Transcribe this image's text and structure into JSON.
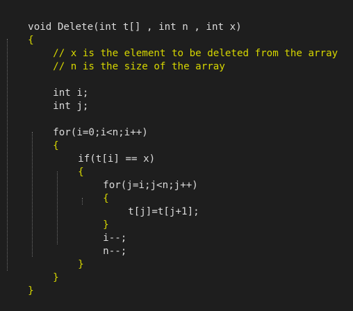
{
  "editor": {
    "lines": [
      {
        "id": "l1",
        "indent": 0,
        "text": "void Delete(int t[] , int n , int x)",
        "kind": "code"
      },
      {
        "id": "l2",
        "indent": 0,
        "text": "{",
        "kind": "brace"
      },
      {
        "id": "l3",
        "indent": 4,
        "text": "// x is the element to be deleted from the array",
        "kind": "comment"
      },
      {
        "id": "l4",
        "indent": 4,
        "text": "// n is the size of the array",
        "kind": "comment"
      },
      {
        "id": "l5",
        "indent": 4,
        "text": "",
        "kind": "code"
      },
      {
        "id": "l6",
        "indent": 4,
        "text": "int i;",
        "kind": "code"
      },
      {
        "id": "l7",
        "indent": 4,
        "text": "int j;",
        "kind": "code"
      },
      {
        "id": "l8",
        "indent": 4,
        "text": "",
        "kind": "code"
      },
      {
        "id": "l9",
        "indent": 4,
        "text": "for(i=0;i<n;i++)",
        "kind": "code"
      },
      {
        "id": "l10",
        "indent": 4,
        "text": "{",
        "kind": "brace"
      },
      {
        "id": "l11",
        "indent": 8,
        "text": "if(t[i] == x)",
        "kind": "code"
      },
      {
        "id": "l12",
        "indent": 8,
        "text": "{",
        "kind": "brace"
      },
      {
        "id": "l13",
        "indent": 12,
        "text": "for(j=i;j<n;j++)",
        "kind": "code"
      },
      {
        "id": "l14",
        "indent": 12,
        "text": "{",
        "kind": "brace"
      },
      {
        "id": "l15",
        "indent": 16,
        "text": "t[j]=t[j+1];",
        "kind": "code"
      },
      {
        "id": "l16",
        "indent": 12,
        "text": "}",
        "kind": "brace"
      },
      {
        "id": "l17",
        "indent": 12,
        "text": "i--;",
        "kind": "code"
      },
      {
        "id": "l18",
        "indent": 12,
        "text": "n--;",
        "kind": "code"
      },
      {
        "id": "l19",
        "indent": 8,
        "text": "}",
        "kind": "brace"
      },
      {
        "id": "l20",
        "indent": 4,
        "text": "}",
        "kind": "brace"
      },
      {
        "id": "l21",
        "indent": 0,
        "text": "}",
        "kind": "brace"
      }
    ]
  },
  "colors": {
    "background": "#1e1e1e",
    "text": "#dcdcdc",
    "comment": "#d7d700",
    "brace": "#d7d700",
    "number": "#b5cea8",
    "guide": "#6e6e6e"
  }
}
